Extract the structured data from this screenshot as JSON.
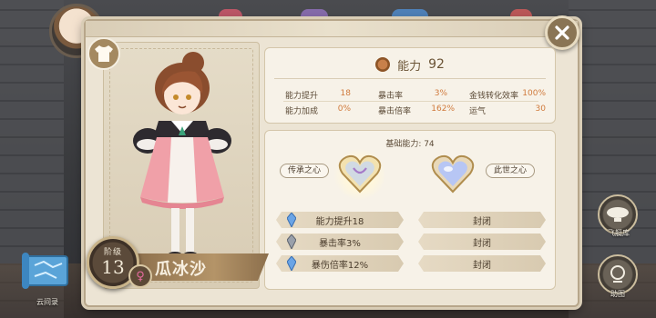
{
  "ability": {
    "label": "能力",
    "value": "92"
  },
  "stats": [
    {
      "label": "能力提升",
      "value": "18"
    },
    {
      "label": "暴击率",
      "value": "3%"
    },
    {
      "label": "金钱转化效率",
      "value": "100%"
    },
    {
      "label": "能力加成",
      "value": "0%"
    },
    {
      "label": "暴击倍率",
      "value": "162%"
    },
    {
      "label": "运气",
      "value": "30"
    }
  ],
  "base_power": "基础能力: 74",
  "hearts": {
    "left_label": "传承之心",
    "right_label": "此世之心"
  },
  "rows": {
    "left": [
      "能力提升18",
      "暴击率3%",
      "暴伤倍率12%"
    ],
    "right": [
      "封闭",
      "封闭",
      "封闭"
    ]
  },
  "character": {
    "rank_label": "阶级",
    "rank": "13",
    "name": "瓜冰沙",
    "gender": "♀"
  },
  "side": {
    "map_label": "云间录",
    "airship_label": "飞艇库",
    "guide_label": "助图"
  },
  "colors": {
    "accent": "#d07a3c",
    "panel": "#ece4d4",
    "gem_blue": "#6aa4e6",
    "gem_gray": "#9aa0aa"
  }
}
